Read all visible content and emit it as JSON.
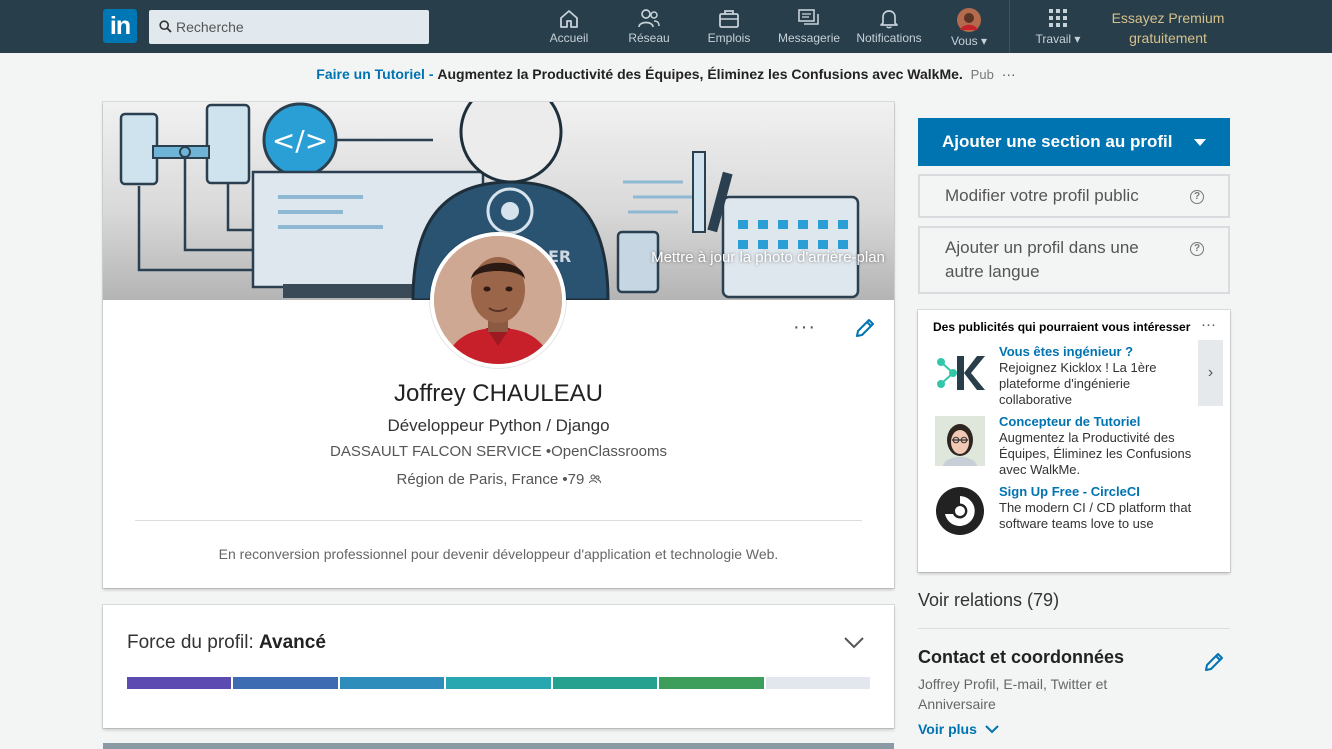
{
  "nav": {
    "logo_text": "in",
    "search_placeholder": "Recherche",
    "items": [
      {
        "label": "Accueil"
      },
      {
        "label": "Réseau"
      },
      {
        "label": "Emplois"
      },
      {
        "label": "Messagerie"
      },
      {
        "label": "Notifications"
      },
      {
        "label": "Vous ▾"
      },
      {
        "label": "Travail ▾"
      }
    ],
    "premium_line1": "Essayez Premium",
    "premium_line2": "gratuitement"
  },
  "ad_banner": {
    "link": "Faire un Tutoriel -",
    "text": "Augmentez la Productivité des Équipes, Éliminez les Confusions avec WalkMe.",
    "pub": "Pub",
    "more": "···"
  },
  "profile": {
    "banner_caption": "Mettre à jour la photo d'arrière-plan",
    "more": "···",
    "name": "Joffrey CHAULEAU",
    "headline": "Développeur Python / Django",
    "company": "DASSAULT FALCON SERVICE  •OpenClassrooms",
    "location": "Région de Paris, France  •79",
    "summary": "En reconversion professionnel pour devenir développeur d'application et technologie Web."
  },
  "strength": {
    "label": "Force du profil:",
    "level": "Avancé",
    "filled_segments": 6,
    "total_segments": 7,
    "colors": [
      "#5c4bb0",
      "#3e6cb2",
      "#2f8dbc",
      "#28a7b0",
      "#26a190",
      "#3d9e5c",
      "#e1e7ec"
    ]
  },
  "sidebar": {
    "add_section": "Ajouter une section au profil",
    "edit_public": "Modifier votre profil public",
    "add_language": "Ajouter un profil dans une autre langue",
    "help": "?",
    "ads_title": "Des publicités qui pourraient vous intéresser",
    "ads_more": "···",
    "ads_next": "›",
    "ads": [
      {
        "title": "Vous êtes ingénieur ?",
        "desc": "Rejoignez Kicklox ! La 1ère plateforme d'ingénierie collaborative"
      },
      {
        "title": "Concepteur de Tutoriel",
        "desc": "Augmentez la Productivité des Équipes, Éliminez les Confusions avec WalkMe."
      },
      {
        "title": "Sign Up Free - CircleCI",
        "desc": "The modern CI / CD platform that software teams love to use"
      }
    ],
    "relations": "Voir relations (79)",
    "contact_title": "Contact et coordonnées",
    "contact_desc": "Joffrey Profil, E-mail, Twitter et Anniversaire",
    "voir_plus": "Voir plus"
  }
}
